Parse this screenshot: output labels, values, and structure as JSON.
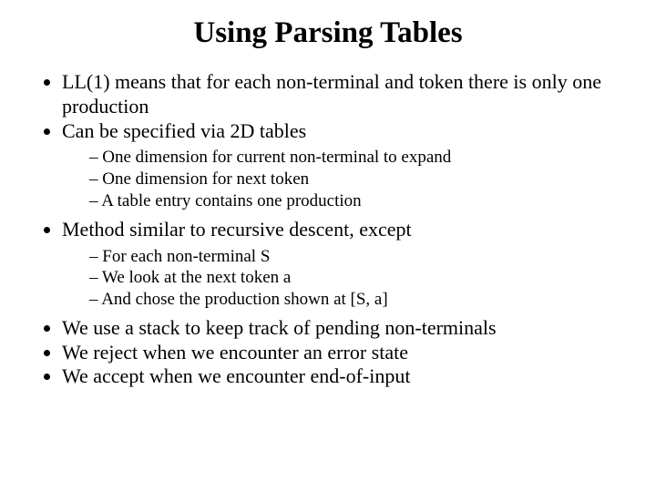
{
  "title": "Using Parsing Tables",
  "b1": "LL(1) means that for each non-terminal and token there is only one production",
  "b2": "Can be specified via 2D tables",
  "b2s1": "One dimension for current non-terminal to expand",
  "b2s2": "One dimension for next token",
  "b2s3": "A table entry contains  one production",
  "b3": "Method similar to recursive descent, except",
  "b3s1": "For each non-terminal S",
  "b3s2": "We look at the next token a",
  "b3s3": "And chose the production shown at [S, a]",
  "b4": "We use a stack to keep track of pending non-terminals",
  "b5": "We reject when we encounter an error state",
  "b6": "We accept when we encounter end-of-input"
}
